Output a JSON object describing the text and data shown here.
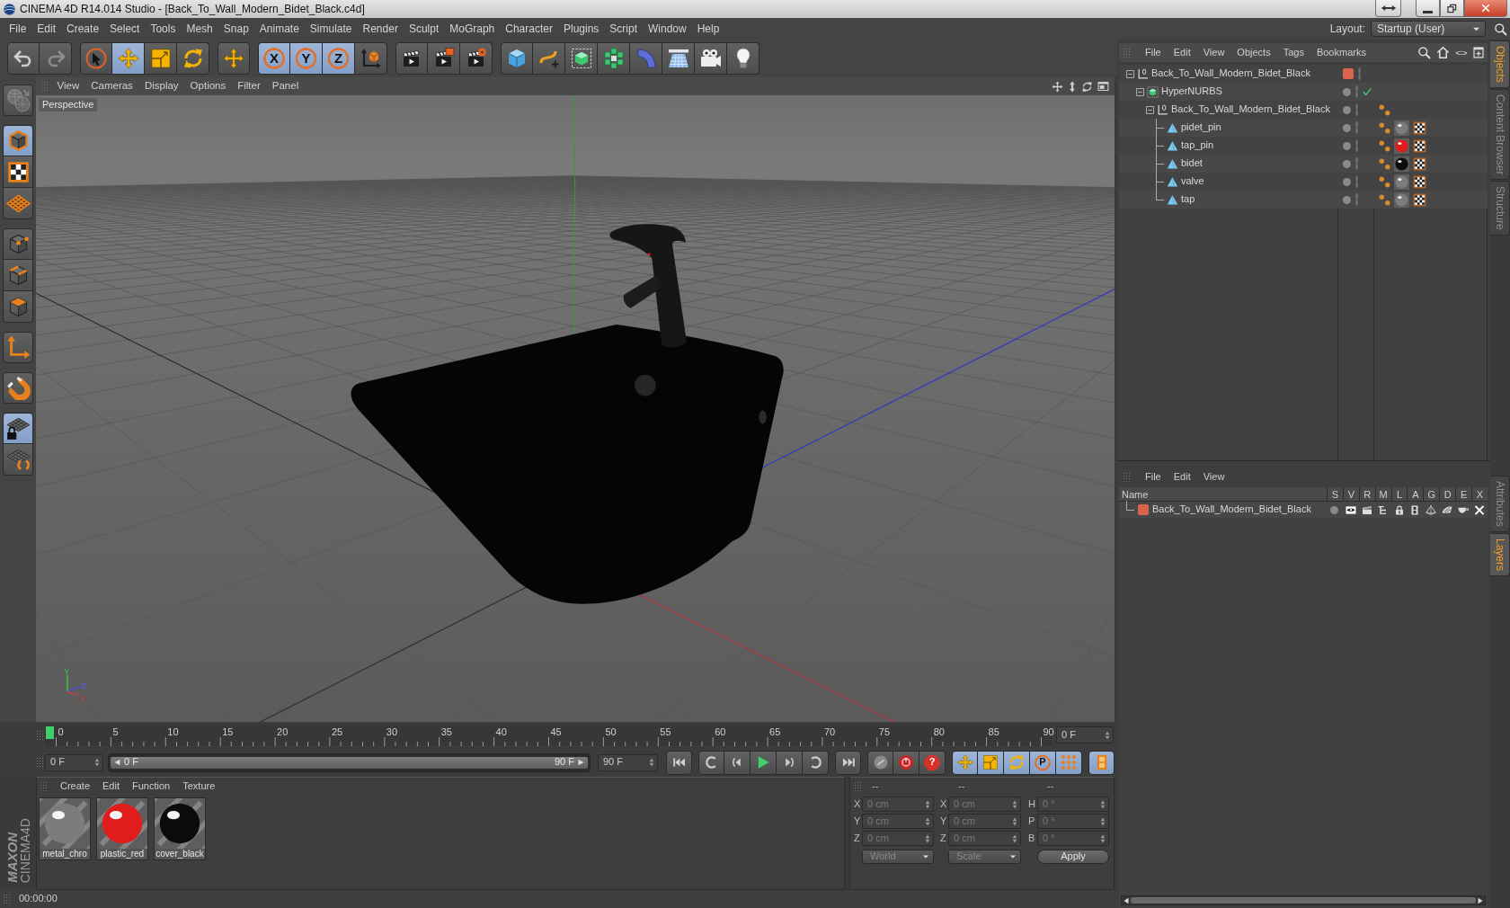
{
  "window": {
    "title": "CINEMA 4D R14.014 Studio - [Back_To_Wall_Modern_Bidet_Black.c4d]"
  },
  "menu_bar": [
    "File",
    "Edit",
    "Create",
    "Select",
    "Tools",
    "Mesh",
    "Snap",
    "Animate",
    "Simulate",
    "Render",
    "Sculpt",
    "MoGraph",
    "Character",
    "Plugins",
    "Script",
    "Window",
    "Help"
  ],
  "layout": {
    "label": "Layout:",
    "value": "Startup (User)"
  },
  "toolbar": [
    {
      "tools": [
        {
          "kind": "undo",
          "selected": false,
          "disabled": false
        },
        {
          "kind": "redo",
          "selected": false,
          "disabled": true
        }
      ]
    },
    {
      "tools": [
        {
          "kind": "live_selection",
          "selected": false,
          "disabled": false
        },
        {
          "kind": "move",
          "selected": true,
          "disabled": false
        },
        {
          "kind": "scale",
          "selected": false,
          "disabled": false
        },
        {
          "kind": "rotate",
          "selected": false,
          "disabled": false
        }
      ]
    },
    {
      "tools": [
        {
          "kind": "plus_move",
          "selected": false,
          "disabled": false
        }
      ]
    },
    {
      "tools": [
        {
          "kind": "axis_lock",
          "label": "X",
          "selected": true,
          "disabled": false
        },
        {
          "kind": "axis_lock",
          "label": "Y",
          "selected": true,
          "disabled": false
        },
        {
          "kind": "axis_lock",
          "label": "Z",
          "selected": true,
          "disabled": false
        },
        {
          "kind": "coordinate_system",
          "selected": false,
          "disabled": false
        }
      ]
    },
    {
      "tools": [
        {
          "kind": "render_view",
          "selected": false,
          "disabled": false
        },
        {
          "kind": "render_picture",
          "selected": false,
          "disabled": false
        },
        {
          "kind": "render_settings",
          "selected": false,
          "disabled": false
        }
      ]
    },
    {
      "tools": [
        {
          "kind": "cube",
          "selected": false,
          "disabled": false
        },
        {
          "kind": "spline",
          "selected": false,
          "disabled": false
        },
        {
          "kind": "subdivision",
          "selected": false,
          "disabled": false
        },
        {
          "kind": "cloner",
          "selected": false,
          "disabled": false
        },
        {
          "kind": "deformer",
          "selected": false,
          "disabled": false
        },
        {
          "kind": "floor",
          "selected": false,
          "disabled": false
        },
        {
          "kind": "camera",
          "selected": false,
          "disabled": false
        },
        {
          "kind": "light",
          "selected": false,
          "disabled": false
        }
      ]
    }
  ],
  "mode_toolbar": [
    {
      "tools": [
        {
          "kind": "make_editable",
          "selected": false,
          "disabled": true
        }
      ]
    },
    {
      "tools": [
        {
          "kind": "model",
          "selected": true,
          "disabled": false
        },
        {
          "kind": "texture",
          "selected": false,
          "disabled": false
        },
        {
          "kind": "workplane",
          "selected": false,
          "disabled": false
        }
      ]
    },
    {
      "tools": [
        {
          "kind": "points",
          "selected": false,
          "disabled": false
        },
        {
          "kind": "edges",
          "selected": false,
          "disabled": false
        },
        {
          "kind": "polygons",
          "selected": false,
          "disabled": false
        }
      ]
    },
    {
      "tools": [
        {
          "kind": "axis",
          "selected": false,
          "disabled": false
        }
      ]
    },
    {
      "tools": [
        {
          "kind": "snap",
          "selected": false,
          "disabled": false
        }
      ]
    },
    {
      "tools": [
        {
          "kind": "workplane_lock",
          "selected": true,
          "disabled": false
        },
        {
          "kind": "planar",
          "selected": false,
          "disabled": false
        }
      ]
    }
  ],
  "viewport": {
    "menu": [
      "View",
      "Cameras",
      "Display",
      "Options",
      "Filter",
      "Panel"
    ],
    "view_name": "Perspective",
    "gizmo_labels": [
      "Y",
      "Z",
      "X"
    ]
  },
  "timeline": {
    "ticks": [
      "0",
      "5",
      "10",
      "15",
      "20",
      "25",
      "30",
      "35",
      "40",
      "45",
      "50",
      "55",
      "60",
      "65",
      "70",
      "75",
      "80",
      "85",
      "90"
    ],
    "playhead": {
      "level": 0
    },
    "frame": "0 F"
  },
  "playback": {
    "start": "0 F",
    "range": {
      "start": "0 F",
      "end": "90 F",
      "level": 1
    },
    "end": "90 F",
    "controls": [
      {
        "buttons": [
          {
            "kind": "go_start",
            "selected": false
          }
        ]
      },
      {
        "buttons": [
          {
            "kind": "prev_key",
            "selected": false
          },
          {
            "kind": "prev_frame",
            "selected": false
          },
          {
            "kind": "play",
            "selected": false
          },
          {
            "kind": "next_frame",
            "selected": false
          },
          {
            "kind": "next_key",
            "selected": false
          }
        ]
      },
      {
        "buttons": [
          {
            "kind": "go_end",
            "selected": false
          }
        ]
      },
      {
        "buttons": [
          {
            "kind": "keyframe",
            "selected": false
          },
          {
            "kind": "record",
            "selected": false
          },
          {
            "kind": "autokey",
            "label": "?",
            "selected": false
          }
        ]
      },
      {
        "buttons": [
          {
            "kind": "move",
            "selected": true
          },
          {
            "kind": "scale",
            "selected": true
          },
          {
            "kind": "rotate",
            "selected": true
          },
          {
            "kind": "parameter",
            "label": "P",
            "selected": true
          },
          {
            "kind": "point_level",
            "selected": true
          }
        ]
      },
      {
        "buttons": [
          {
            "kind": "timeline",
            "selected": true
          }
        ]
      }
    ]
  },
  "materials": {
    "menu": [
      "Create",
      "Edit",
      "Function",
      "Texture"
    ],
    "items": [
      {
        "name": "metal_chro",
        "color": "#7c7c7c"
      },
      {
        "name": "plastic_red",
        "color": "#e01c1c"
      },
      {
        "name": "cover_black",
        "color": "#0c0c0c"
      }
    ]
  },
  "coordinates": {
    "headers": [
      "--",
      "--",
      "--"
    ],
    "disabled": true,
    "rows": [
      {
        "labels": [
          "X",
          "X",
          "H"
        ],
        "values": [
          "0 cm",
          "0 cm",
          "0 °"
        ]
      },
      {
        "labels": [
          "Y",
          "Y",
          "P"
        ],
        "values": [
          "0 cm",
          "0 cm",
          "0 °"
        ]
      },
      {
        "labels": [
          "Z",
          "Z",
          "B"
        ],
        "values": [
          "0 cm",
          "0 cm",
          "0 °"
        ]
      }
    ],
    "dropdowns": [
      "World",
      "Scale"
    ],
    "apply": "Apply"
  },
  "logo": {
    "wordmark": "MAXON",
    "product": "CINEMA4D"
  },
  "status_bar": {
    "text": "00:00:00"
  },
  "object_manager": {
    "menu": [
      "File",
      "Edit",
      "View",
      "Objects",
      "Tags",
      "Bookmarks"
    ],
    "objects": [
      {
        "name": "Back_To_Wall_Modern_Bidet_Black",
        "kind": "null",
        "expanded": true,
        "color": "#d9644e",
        "children": [
          {
            "name": "HyperNURBS",
            "kind": "subdivision",
            "expanded": true,
            "enabled": true,
            "children": [
              {
                "name": "Back_To_Wall_Modern_Bidet_Black",
                "kind": "null",
                "expanded": true,
                "tags": [
                  {
                    "kind": "phong"
                  }
                ],
                "children": [
                  {
                    "name": "pidet_pin",
                    "kind": "polygon",
                    "tags": [
                      {
                        "kind": "phong"
                      },
                      {
                        "kind": "material",
                        "color": "#7c7c7c"
                      },
                      {
                        "kind": "uvw"
                      }
                    ]
                  },
                  {
                    "name": "tap_pin",
                    "kind": "polygon",
                    "tags": [
                      {
                        "kind": "phong"
                      },
                      {
                        "kind": "material",
                        "color": "#e01c1c"
                      },
                      {
                        "kind": "uvw"
                      }
                    ]
                  },
                  {
                    "name": "bidet",
                    "kind": "polygon",
                    "tags": [
                      {
                        "kind": "phong"
                      },
                      {
                        "kind": "material",
                        "color": "#0c0c0c"
                      },
                      {
                        "kind": "uvw"
                      }
                    ]
                  },
                  {
                    "name": "valve",
                    "kind": "polygon",
                    "tags": [
                      {
                        "kind": "phong"
                      },
                      {
                        "kind": "material",
                        "color": "#7c7c7c"
                      },
                      {
                        "kind": "uvw"
                      }
                    ]
                  },
                  {
                    "name": "tap",
                    "kind": "polygon",
                    "tags": [
                      {
                        "kind": "phong"
                      },
                      {
                        "kind": "material",
                        "color": "#7c7c7c"
                      },
                      {
                        "kind": "uvw"
                      }
                    ]
                  }
                ]
              }
            ]
          }
        ]
      }
    ]
  },
  "layer_manager": {
    "menu": [
      "File",
      "Edit",
      "View"
    ],
    "columns": [
      "Name",
      "S",
      "V",
      "R",
      "M",
      "L",
      "A",
      "G",
      "D",
      "E",
      "X"
    ],
    "layers": [
      {
        "name": "Back_To_Wall_Modern_Bidet_Black",
        "color": "#d9644e"
      }
    ]
  },
  "side_tabs_top": [
    {
      "label": "Objects",
      "selected": true
    },
    {
      "label": "Content Browser",
      "selected": false
    },
    {
      "label": "Structure",
      "selected": false
    }
  ],
  "side_tabs_bottom": [
    {
      "label": "Attributes",
      "selected": false
    },
    {
      "label": "Layers",
      "selected": true
    }
  ]
}
